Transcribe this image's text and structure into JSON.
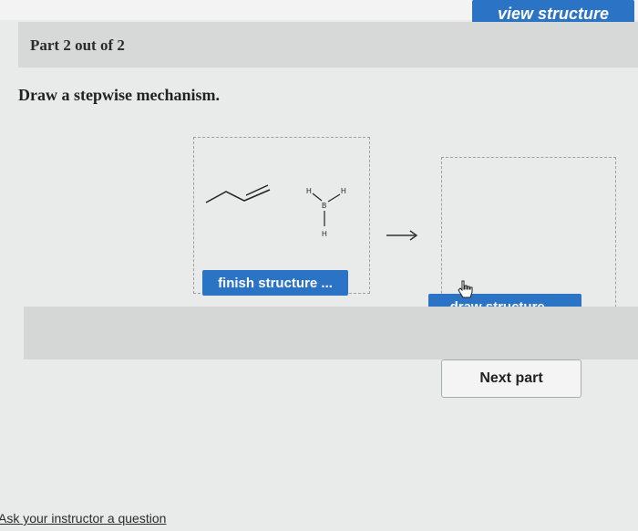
{
  "toolbar": {
    "view_structure_label": "view structure"
  },
  "part": {
    "label": "Part 2 out of 2"
  },
  "question": {
    "prompt": "Draw a stepwise mechanism."
  },
  "reactant_panel": {
    "button_label": "finish structure ...",
    "atoms": {
      "h_top_left": "H",
      "boron": "B",
      "h_top_right": "H",
      "h_bottom": "H"
    }
  },
  "product_panel": {
    "button_label": "draw structure ..."
  },
  "navigation": {
    "next_label": "Next part"
  },
  "footer": {
    "ask_link": "Ask your instructor a question"
  },
  "colors": {
    "accent": "#2a73c5",
    "background": "#e9ebea",
    "bar": "#d7d9d8"
  },
  "icons": {
    "arrow": "right-arrow-icon",
    "cursor": "hand-pointer-icon"
  }
}
